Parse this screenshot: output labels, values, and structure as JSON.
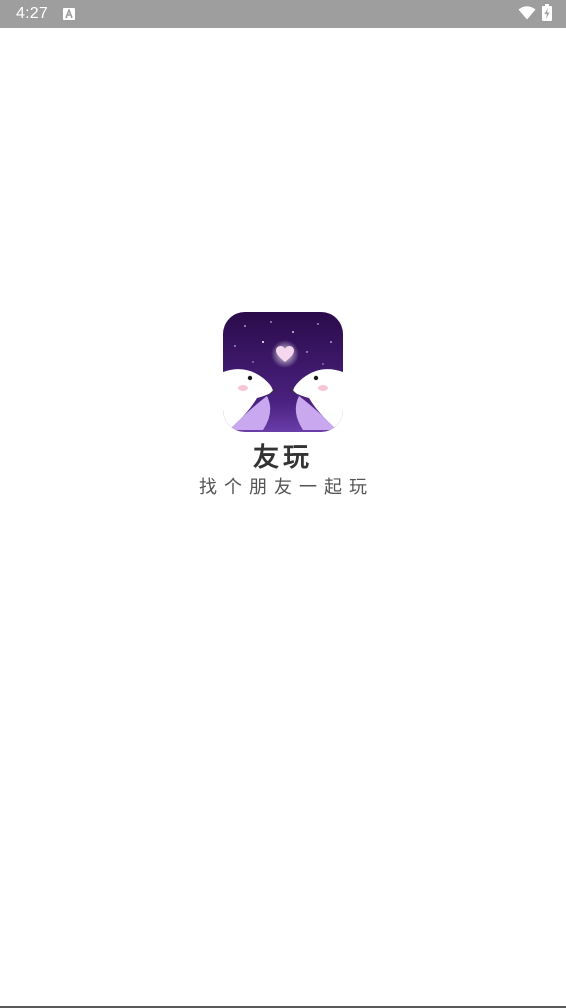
{
  "status_bar": {
    "time": "4:27",
    "notification_icon": "a-icon",
    "wifi_icon": "wifi-icon",
    "battery_icon": "battery-charging-icon",
    "background_color": "#9e9e9e"
  },
  "splash": {
    "logo_icon": "app-logo-icon",
    "app_name": "友玩",
    "slogan": "找个朋友一起玩",
    "logo_colors": {
      "sky_top": "#2b0b4a",
      "sky_bottom": "#6a3da8",
      "bird_wing": "#c9a8f0",
      "heart": "#f7d7ee"
    }
  }
}
